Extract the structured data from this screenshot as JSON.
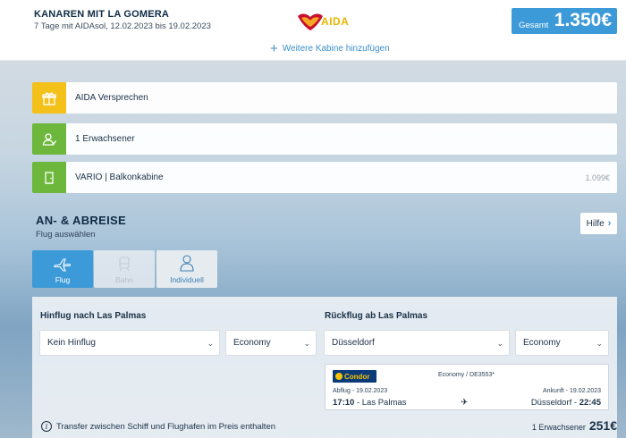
{
  "header": {
    "trip_title": "KANAREN MIT LA GOMERA",
    "trip_subtitle": "7 Tage mit AIDAsol, 12.02.2023 bis 19.02.2023",
    "logo_text": "AIDA",
    "total_label": "Gesamt",
    "total_value": "1.350€",
    "add_cabin": "Weitere Kabine hinzufügen"
  },
  "summary": {
    "promise": "AIDA Versprechen",
    "travelers": "1 Erwachsener",
    "cabin": "VARIO | Balkonkabine",
    "cabin_price": "1.099€"
  },
  "travel": {
    "title": "AN- & ABREISE",
    "subtitle": "Flug auswählen",
    "help_label": "Hilfe",
    "tabs": [
      {
        "label": "Flug",
        "state": "active"
      },
      {
        "label": "Bahn",
        "state": "disabled"
      },
      {
        "label": "Individuell",
        "state": "normal"
      }
    ]
  },
  "outbound": {
    "heading": "Hinflug nach Las Palmas",
    "airport_value": "Kein Hinflug",
    "class_value": "Economy"
  },
  "return": {
    "heading": "Rückflug ab Las Palmas",
    "airport_value": "Düsseldorf",
    "class_value": "Economy"
  },
  "flight_card": {
    "airline": "Condor",
    "class_code": "Economy / DE3553*",
    "departure_label": "Abflug - 19.02.2023",
    "departure_time": "17:10",
    "departure_place": "Las Palmas",
    "arrival_label": "Ankunft - 19.02.2023",
    "arrival_place": "Düsseldorf",
    "arrival_time": "22:45"
  },
  "footer": {
    "transfer_text": "Transfer zwischen Schiff und Flughafen im Preis enthalten",
    "pax_label": "1 Erwachsener",
    "pax_price": "251€"
  },
  "colors": {
    "accent": "#3d9ad8",
    "promise_icon_bg": "#f3c11a",
    "traveler_icon_bg": "#6db73c"
  }
}
